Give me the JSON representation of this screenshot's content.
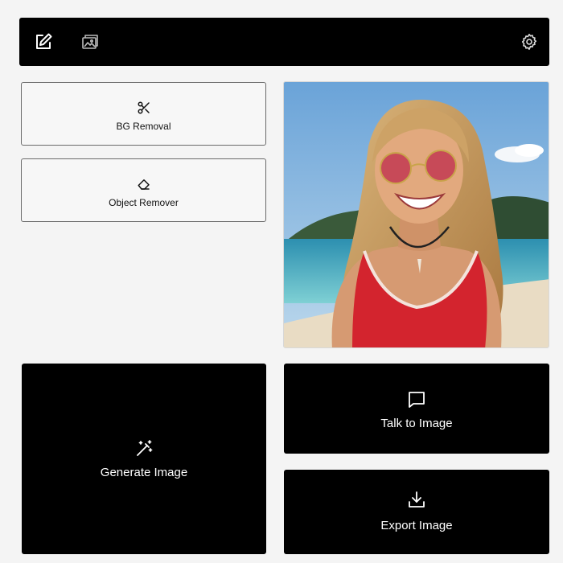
{
  "toolbar": {
    "icons": [
      "edit-square-icon",
      "image-gallery-icon",
      "settings-gear-icon"
    ]
  },
  "tools": {
    "bg_removal": {
      "label": "BG Removal",
      "icon": "scissors-icon"
    },
    "object_remover": {
      "label": "Object Remover",
      "icon": "eraser-icon"
    }
  },
  "preview": {
    "description_icon": "photo-preview"
  },
  "actions": {
    "generate": {
      "label": "Generate Image",
      "icon": "magic-wand-icon"
    },
    "talk": {
      "label": "Talk to Image",
      "icon": "chat-bubble-icon"
    },
    "export": {
      "label": "Export Image",
      "icon": "download-icon"
    }
  },
  "colors": {
    "background": "#f4f4f4",
    "bar": "#000000",
    "card_border": "#6a6a6a",
    "text_light": "#ffffff"
  }
}
